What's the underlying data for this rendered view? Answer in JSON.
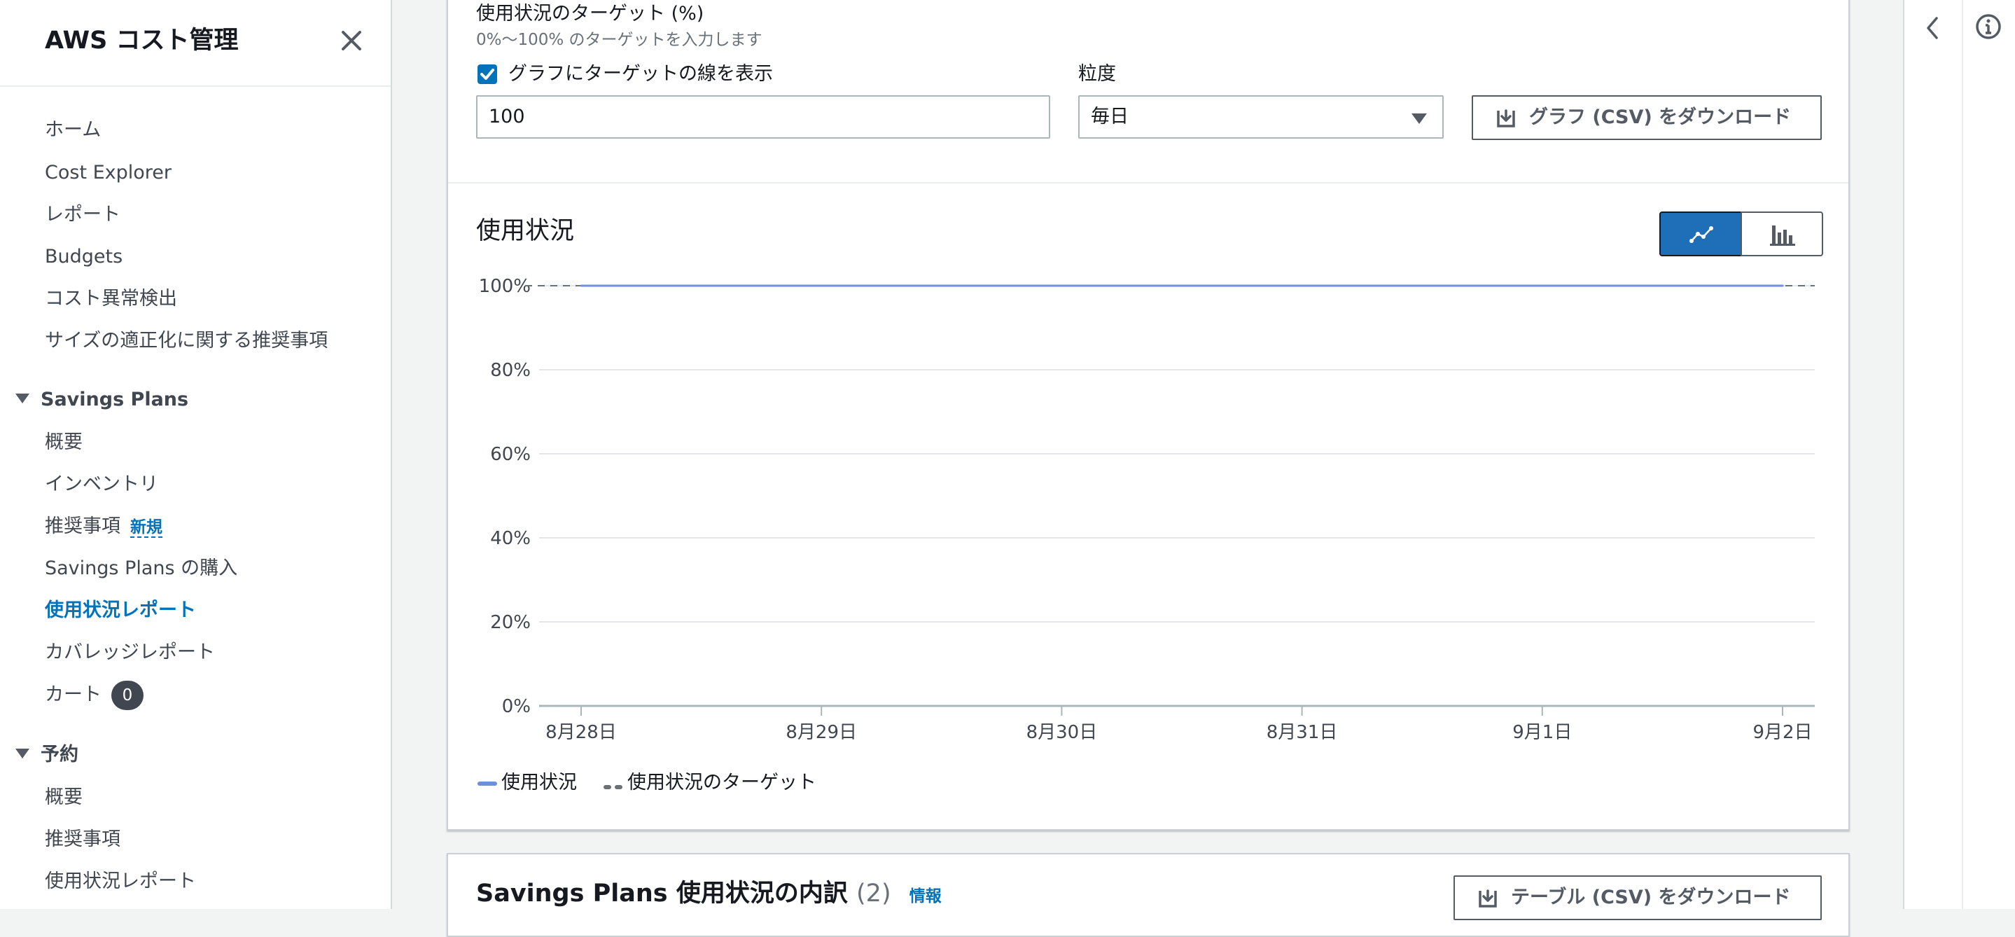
{
  "sidebar": {
    "title": "AWS コスト管理",
    "items_top": [
      "ホーム",
      "Cost Explorer",
      "レポート",
      "Budgets",
      "コスト異常検出",
      "サイズの適正化に関する推奨事項"
    ],
    "savings_plans": {
      "heading": "Savings Plans",
      "overview": "概要",
      "inventory": "インベントリ",
      "recommendations": "推奨事項",
      "recommendations_badge": "新規",
      "purchase": "Savings Plans の購入",
      "utilization_report": "使用状況レポート",
      "coverage_report": "カバレッジレポート",
      "cart": "カート",
      "cart_count": "0"
    },
    "reservations": {
      "heading": "予約",
      "overview": "概要",
      "recommendations": "推奨事項",
      "utilization_report": "使用状況レポート"
    }
  },
  "filters": {
    "target_label": "使用状況のターゲット (%)",
    "target_hint": "0%〜100% のターゲットを入力します",
    "show_target_label": "グラフにターゲットの線を表示",
    "show_target_checked": true,
    "target_value": "100",
    "granularity_label": "粒度",
    "granularity_value": "毎日",
    "download_chart_label": "グラフ (CSV) をダウンロード"
  },
  "chart_panel": {
    "title": "使用状況",
    "view_line": "line-chart-icon",
    "view_bar": "bar-chart-icon"
  },
  "chart_data": {
    "type": "line",
    "title": "使用状況",
    "x": [
      "8月28日",
      "8月29日",
      "8月30日",
      "8月31日",
      "9月1日",
      "9月2日"
    ],
    "y_ticks": [
      "0%",
      "20%",
      "40%",
      "60%",
      "80%",
      "100%"
    ],
    "ylim": [
      0,
      100
    ],
    "series": [
      {
        "name": "使用状況",
        "values": [
          100,
          100,
          100,
          100,
          100,
          100
        ],
        "color": "#6f8fdc"
      },
      {
        "name": "使用状況のターゲット",
        "values": [
          100,
          100,
          100,
          100,
          100,
          100
        ],
        "color": "#687078",
        "style": "dashed"
      }
    ],
    "grid": true,
    "legend_position": "bottom-left"
  },
  "breakdown": {
    "title": "Savings Plans 使用状況の内訳",
    "count": "(2)",
    "info": "情報",
    "download_table_label": "テーブル (CSV) をダウンロード"
  },
  "colors": {
    "accent": "#0073bb",
    "selected_toggle": "#1f6fb8",
    "series_line": "#6f8fdc"
  }
}
